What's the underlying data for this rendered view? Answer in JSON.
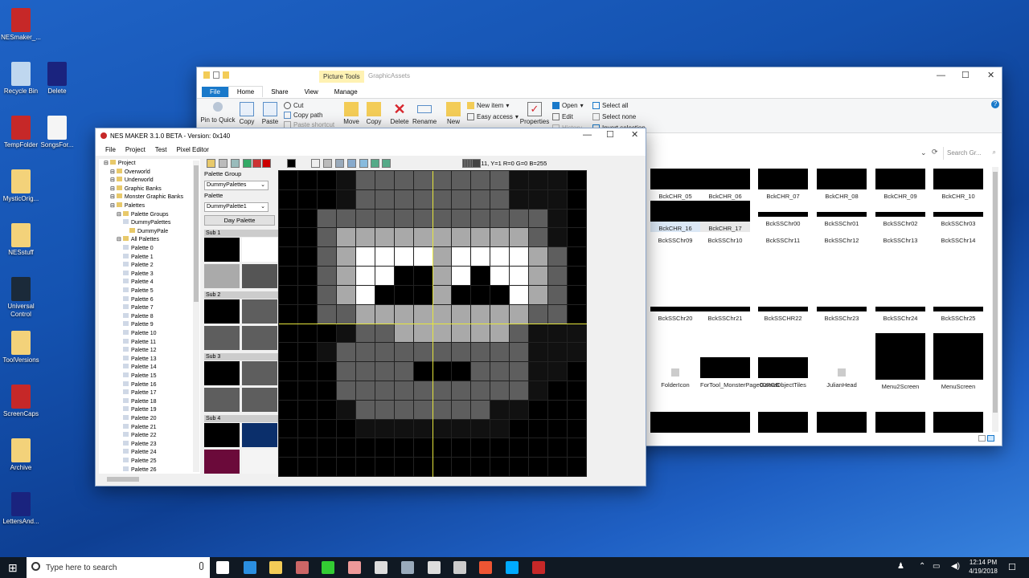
{
  "desktop_icons": [
    {
      "label": "NESmaker_...",
      "color": "#c62828"
    },
    {
      "label": "Recycle Bin",
      "color": "#bfd7ef"
    },
    {
      "label": "Delete",
      "color": "#1a237e"
    },
    {
      "label": "TempFolder",
      "color": "#c62828"
    },
    {
      "label": "SongsFor...",
      "color": "#f5f5f5"
    },
    {
      "label": "MysticOrig...",
      "color": "#f3d27a"
    },
    {
      "label": "NESstuff",
      "color": "#f3d27a"
    },
    {
      "label": "Universal Control",
      "color": "#1b2a3a"
    },
    {
      "label": "ToolVersions",
      "color": "#f3d27a"
    },
    {
      "label": "ScreenCaps",
      "color": "#c62828"
    },
    {
      "label": "Archive",
      "color": "#f3d27a"
    },
    {
      "label": "LettersAnd...",
      "color": "#1a237e"
    }
  ],
  "explorer": {
    "context_tab": "Picture Tools",
    "title": "GraphicAssets",
    "tabs": [
      "File",
      "Home",
      "Share",
      "View",
      "Manage"
    ],
    "ribbon": {
      "pin": "Pin to Quick",
      "copy": "Copy",
      "paste": "Paste",
      "cut": "Cut",
      "copy_path": "Copy path",
      "paste_shortcut": "Paste shortcut",
      "move": "Move",
      "copy_to": "Copy",
      "delete": "Delete",
      "rename": "Rename",
      "new_folder": "New",
      "new_item": "New item",
      "easy_access": "Easy access",
      "properties": "Properties",
      "open": "Open",
      "edit": "Edit",
      "history": "History",
      "select_all": "Select all",
      "select_none": "Select none",
      "invert": "Invert selection"
    },
    "search_placeholder": "Search Gr...",
    "thumbnails": [
      {
        "label": "BckCHR_05",
        "kind": "strip"
      },
      {
        "label": "BckCHR_06",
        "kind": "strip"
      },
      {
        "label": "BckCHR_07",
        "kind": "strip"
      },
      {
        "label": "BckCHR_08",
        "kind": "strip"
      },
      {
        "label": "BckCHR_09",
        "kind": "strip"
      },
      {
        "label": "BckCHR_10",
        "kind": "strip"
      },
      {
        "label": "BckCHR_16",
        "kind": "strip"
      },
      {
        "label": "BckCHR_17",
        "kind": "strip"
      },
      {
        "label": "BckSSChr00",
        "kind": "thin"
      },
      {
        "label": "BckSSChr01",
        "kind": "thin"
      },
      {
        "label": "BckSSChr02",
        "kind": "thin"
      },
      {
        "label": "BckSSChr03",
        "kind": "thin"
      },
      {
        "label": "BckSSChr09",
        "kind": "none"
      },
      {
        "label": "BckSSChr10",
        "kind": "none"
      },
      {
        "label": "BckSSChr11",
        "kind": "none"
      },
      {
        "label": "BckSSChr12",
        "kind": "none"
      },
      {
        "label": "BckSSChr13",
        "kind": "none"
      },
      {
        "label": "BckSSChr14",
        "kind": "none"
      },
      {
        "label": "BckSSChr20",
        "kind": "thin"
      },
      {
        "label": "BckSSChr21",
        "kind": "thin"
      },
      {
        "label": "BckSSCHR22",
        "kind": "thin"
      },
      {
        "label": "BckSSChr23",
        "kind": "thin"
      },
      {
        "label": "BckSSChr24",
        "kind": "thin"
      },
      {
        "label": "BckSSChr25",
        "kind": "thin"
      },
      {
        "label": "FolderIcon",
        "kind": "icon"
      },
      {
        "label": "ForTool_MonsterPage00RGB",
        "kind": "strip"
      },
      {
        "label": "GameObjectTiles",
        "kind": "strip"
      },
      {
        "label": "JulianHead",
        "kind": "icon"
      },
      {
        "label": "Menu2Screen",
        "kind": "big"
      },
      {
        "label": "MenuScreen",
        "kind": "big"
      }
    ]
  },
  "nes": {
    "title": "NES MAKER 3.1.0 BETA  - Version: 0x140",
    "menu": [
      "File",
      "Project",
      "Test",
      "Pixel Editor"
    ],
    "status": "X=11, Y=1 R=0 G=0 B=255",
    "tree": [
      {
        "label": "Project",
        "indent": 0
      },
      {
        "label": "Overworld",
        "indent": 1
      },
      {
        "label": "Underworld",
        "indent": 1
      },
      {
        "label": "Graphic Banks",
        "indent": 1
      },
      {
        "label": "Monster Graphic Banks",
        "indent": 1
      },
      {
        "label": "Palettes",
        "indent": 1
      },
      {
        "label": "Palette Groups",
        "indent": 2
      },
      {
        "label": "DummyPalettes",
        "indent": 3
      },
      {
        "label": "DummyPale",
        "indent": 4
      },
      {
        "label": "All Palettes",
        "indent": 2
      },
      {
        "label": "Palette 0",
        "indent": 3
      },
      {
        "label": "Palette 1",
        "indent": 3
      },
      {
        "label": "Palette 2",
        "indent": 3
      },
      {
        "label": "Palette 3",
        "indent": 3
      },
      {
        "label": "Palette 4",
        "indent": 3
      },
      {
        "label": "Palette 5",
        "indent": 3
      },
      {
        "label": "Palette 6",
        "indent": 3
      },
      {
        "label": "Palette 7",
        "indent": 3
      },
      {
        "label": "Palette 8",
        "indent": 3
      },
      {
        "label": "Palette 9",
        "indent": 3
      },
      {
        "label": "Palette 10",
        "indent": 3
      },
      {
        "label": "Palette 11",
        "indent": 3
      },
      {
        "label": "Palette 12",
        "indent": 3
      },
      {
        "label": "Palette 13",
        "indent": 3
      },
      {
        "label": "Palette 14",
        "indent": 3
      },
      {
        "label": "Palette 15",
        "indent": 3
      },
      {
        "label": "Palette 16",
        "indent": 3
      },
      {
        "label": "Palette 17",
        "indent": 3
      },
      {
        "label": "Palette 18",
        "indent": 3
      },
      {
        "label": "Palette 19",
        "indent": 3
      },
      {
        "label": "Palette 20",
        "indent": 3
      },
      {
        "label": "Palette 21",
        "indent": 3
      },
      {
        "label": "Palette 22",
        "indent": 3
      },
      {
        "label": "Palette 23",
        "indent": 3
      },
      {
        "label": "Palette 24",
        "indent": 3
      },
      {
        "label": "Palette 25",
        "indent": 3
      },
      {
        "label": "Palette 26",
        "indent": 3
      }
    ],
    "side": {
      "palette_group_label": "Palette Group",
      "palette_group_value": "DummyPalettes",
      "palette_label": "Palette",
      "palette_value": "DummyPalette1",
      "day_palette_button": "Day Palette",
      "subs": [
        {
          "label": "Sub 1",
          "colors": [
            "#000000",
            "#ffffff",
            "#aaaaaa",
            "#555555"
          ]
        },
        {
          "label": "Sub 2",
          "colors": [
            "#000000",
            "#5e5e5e",
            "#5e5e5e",
            "#5e5e5e"
          ]
        },
        {
          "label": "Sub 3",
          "colors": [
            "#000000",
            "#5e5e5e",
            "#5e5e5e",
            "#5e5e5e"
          ]
        },
        {
          "label": "Sub 4",
          "colors": [
            "#000000",
            "#0b2f6b",
            "#6b0a3a",
            "#f4f4f4"
          ]
        }
      ]
    },
    "pixel_rows": [
      "000BGGGGGGGGBBB0",
      "000BGGGGGGGGBBB0",
      "00GGGGGGGGGGGGB0",
      "00GLLLLLLLLLLGB0",
      "00GLWWWWLWWWWLG0",
      "00GLWWKKLWKWWLG0",
      "00GLWKKKLKKKWLG0",
      "00GGLLLLLLLLLGG0",
      "000BGGLLLLLLGBBB",
      "00BGGGGGGGGGGBBB",
      "000GGGGKKKGGGBB0",
      "000GGGGGGGGGGB00",
      "000BGGGGGGGBB000",
      "0000BBBBBBBB0000",
      "0000000000000000",
      "0000000000000000"
    ],
    "pixel_colors": {
      "0": "#000000",
      "B": "#111111",
      "G": "#5e5e5e",
      "L": "#a9a9a9",
      "W": "#ffffff",
      "K": "#000000"
    }
  },
  "taskbar": {
    "search_placeholder": "Type here to search",
    "time": "12:14 PM",
    "date": "4/19/2018"
  }
}
